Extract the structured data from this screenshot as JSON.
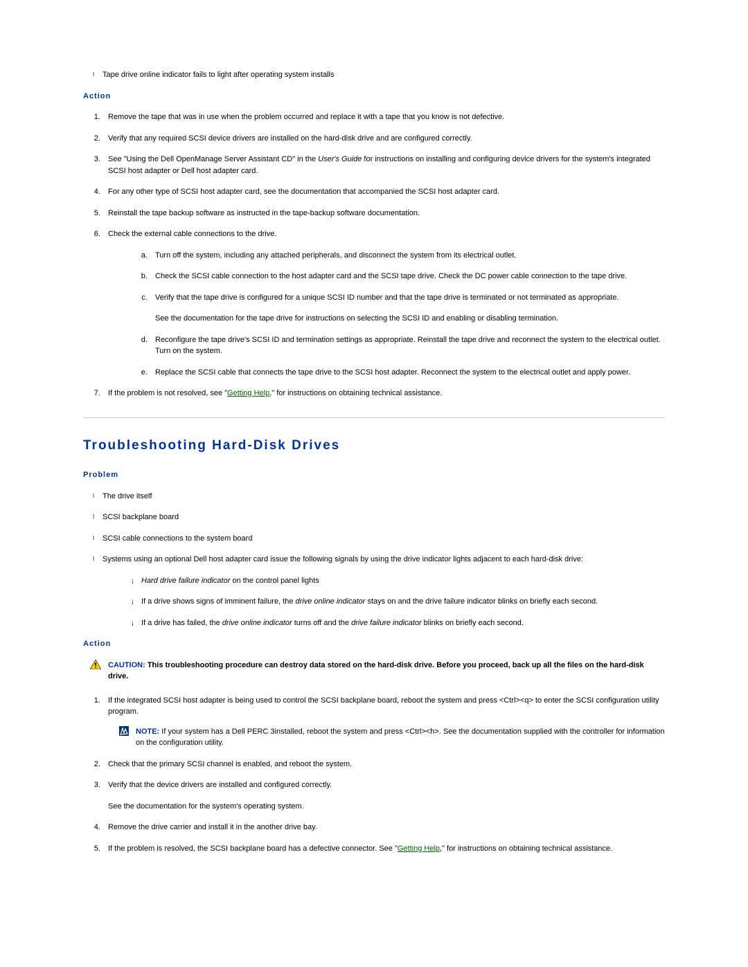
{
  "top_bullets": [
    "Tape drive online indicator fails to light after operating system installs"
  ],
  "action_label": "Action",
  "steps_top": {
    "s1": "Remove the tape that was in use when the problem occurred and replace it with a tape that you know is not defective.",
    "s2": "Verify that any required SCSI device drivers are installed on the hard-disk drive and are configured correctly.",
    "s3a": "See \"Using the Dell OpenManage Server Assistant CD\" in the ",
    "s3i": "User's Guide",
    "s3b": " for instructions on installing and configuring device drivers for the system's integrated SCSI host adapter or Dell host adapter card.",
    "s4": "For any other type of SCSI host adapter card, see the documentation that accompanied the SCSI host adapter card.",
    "s5": "Reinstall the tape backup software as instructed in the tape-backup software documentation.",
    "s6": "Check the external cable connections to the drive.",
    "s6a": "Turn off the system, including any attached peripherals, and disconnect the system from its electrical outlet.",
    "s6b": "Check the SCSI cable connection to the host adapter card and the SCSI tape drive. Check the DC power cable connection to the tape drive.",
    "s6c": "Verify that the tape drive is configured for a unique SCSI ID number and that the tape drive is terminated or not terminated as appropriate.",
    "s6c2": "See the documentation for the tape drive for instructions on selecting the SCSI ID and enabling or disabling termination.",
    "s6d": "Reconfigure the tape drive's SCSI ID and termination settings as appropriate. Reinstall the tape drive and reconnect the system to the electrical outlet. Turn on the system.",
    "s6e": "Replace the SCSI cable that connects the tape drive to the SCSI host adapter. Reconnect the system to the electrical outlet and apply power.",
    "s7a": "If the problem is not resolved, see \"",
    "s7link": "Getting Help",
    "s7b": ",\" for instructions on obtaining technical assistance."
  },
  "section_title": "Troubleshooting Hard-Disk Drives",
  "problem_label": "Problem",
  "problem_bullets": {
    "b1": "The drive itself",
    "b2": "SCSI backplane board",
    "b3": "SCSI cable connections to the system board",
    "b4": "Systems using an optional Dell host adapter card issue the following signals by using the drive indicator lights adjacent to each hard-disk drive:"
  },
  "problem_sub": {
    "a1i": "Hard drive failure indicator",
    "a1t": " on the control panel lights",
    "a2a": "If a drive shows signs of imminent failure, the ",
    "a2i": "drive online indicator",
    "a2b": " stays on and the drive failure indicator blinks on briefly each second.",
    "a3a": "If a drive has failed, the ",
    "a3i1": "drive online indicator",
    "a3b": " turns off and the ",
    "a3i2": "drive failure indicator",
    "a3c": " blinks on briefly each second."
  },
  "caution_label": "CAUTION: ",
  "caution_text": "This troubleshooting procedure can destroy data stored on the hard-disk drive. Before you proceed, back up all the files on the hard-disk drive.",
  "steps_bottom": {
    "s1": "If the integrated SCSI host adapter is being used to control the SCSI backplane board, reboot the system and press <Ctrl><q> to enter the SCSI configuration utility program.",
    "note_label": "NOTE: ",
    "note_text": "If your system has a Dell PERC 3installed, reboot the system and press <Ctrl><h>. See the documentation supplied with the controller for information on the configuration utility.",
    "s2": "Check that the primary SCSI channel is enabled, and reboot the system.",
    "s3": "Verify that the device drivers are installed and configured correctly.",
    "s3b": "See the documentation for the system's operating system.",
    "s4": "Remove the drive carrier and install it in the another drive bay.",
    "s5a": "If the problem is resolved, the SCSI backplane board has a defective connector. See \"",
    "s5link": "Getting Help",
    "s5b": ",\" for instructions on obtaining technical assistance."
  }
}
